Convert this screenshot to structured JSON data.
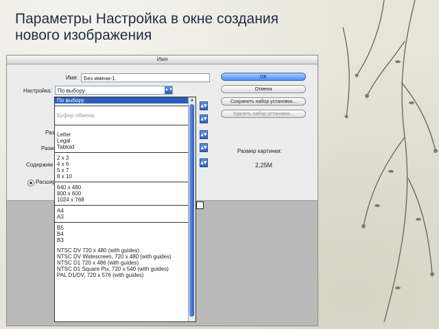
{
  "slide": {
    "title": "Параметры Настройка в окне создания нового изображения"
  },
  "dialog": {
    "window_title": "Имя",
    "name_label": "Имя:",
    "name_value": "Без имени-1",
    "preset_label": "Настройка:",
    "preset_value": "По выбору",
    "hidden_labels": [
      "Разр",
      "Разм",
      "Содержим"
    ],
    "image_size_label": "Размер картинки:",
    "image_size_value": "2,25M",
    "advanced_label": "Расшир"
  },
  "buttons": {
    "ok": "OK",
    "cancel": "Отмена",
    "save_preset": "Сохранить набор установок...",
    "delete_preset": "Удалить набор установок..."
  },
  "dropdown": {
    "groups": [
      {
        "items": [
          "По выбору"
        ],
        "selected": 0
      },
      {
        "items": [
          "Буфер обмена"
        ],
        "muted": true
      },
      {
        "items": [
          "Letter",
          "Legal",
          "Tabloid"
        ]
      },
      {
        "items": [
          "2 x 3",
          "4 x 6",
          "5 x 7",
          "8 x 10"
        ]
      },
      {
        "items": [
          "640 x 480",
          "800 x 600",
          "1024 x 768"
        ]
      },
      {
        "items": [
          "A4",
          "A3"
        ]
      },
      {
        "items": [
          "B5",
          "B4",
          "B3"
        ]
      },
      {
        "items": [
          "NTSC DV 720 x 480 (with guides)",
          "NTSC DV Widescreen, 720 x 480 (with guides)",
          "NTSC D1 720 x 486 (with guides)",
          "NTSC D1 Square Pix, 720 x 540 (with guides)",
          "PAL D1/DV, 720 x 576 (with guides)"
        ]
      }
    ]
  },
  "colors": {
    "selection": "#2a5ebd",
    "accent_button": "#4e8ff0",
    "scrollbar": "#2c5cc0"
  }
}
